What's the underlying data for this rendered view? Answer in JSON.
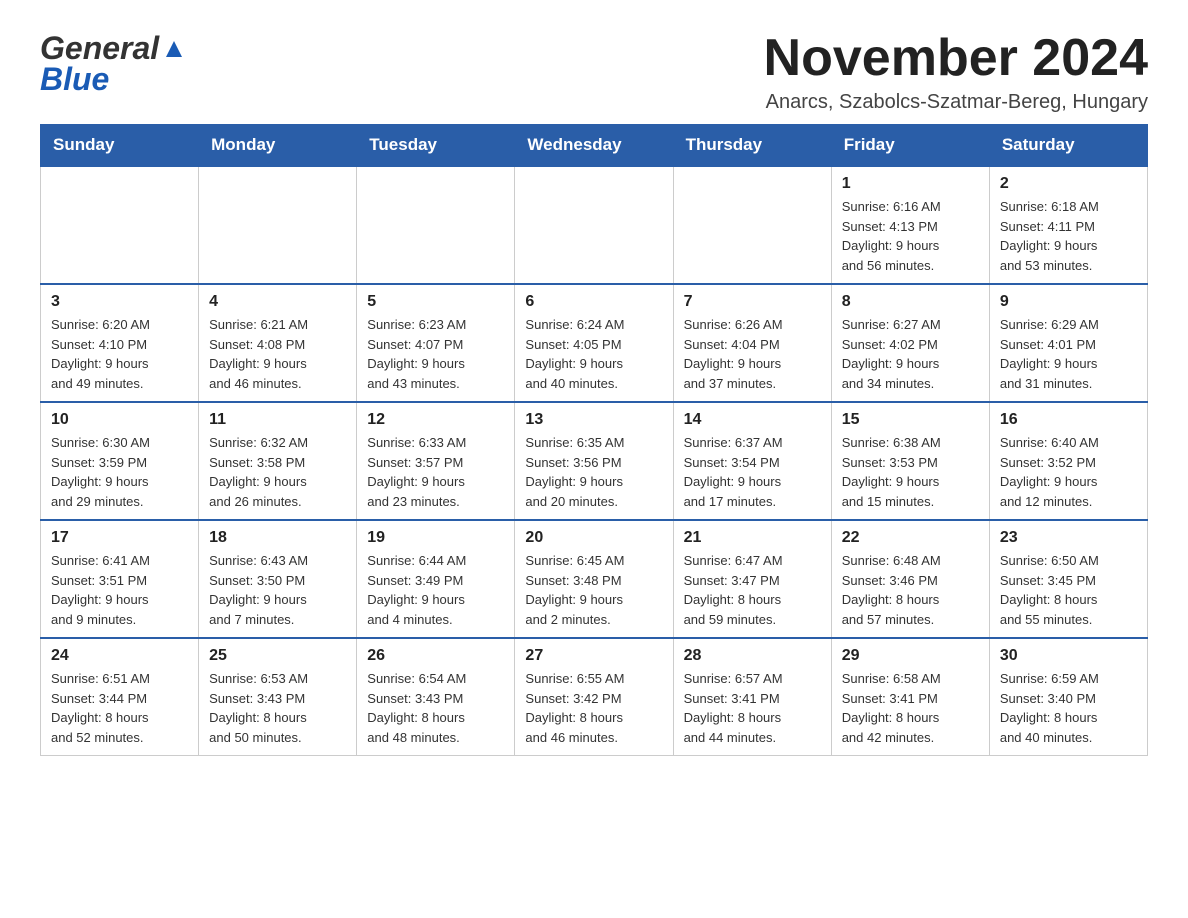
{
  "header": {
    "logo_general": "General",
    "logo_blue": "Blue",
    "month_title": "November 2024",
    "location": "Anarcs, Szabolcs-Szatmar-Bereg, Hungary"
  },
  "days_of_week": [
    "Sunday",
    "Monday",
    "Tuesday",
    "Wednesday",
    "Thursday",
    "Friday",
    "Saturday"
  ],
  "weeks": [
    {
      "days": [
        {
          "number": "",
          "info": ""
        },
        {
          "number": "",
          "info": ""
        },
        {
          "number": "",
          "info": ""
        },
        {
          "number": "",
          "info": ""
        },
        {
          "number": "",
          "info": ""
        },
        {
          "number": "1",
          "info": "Sunrise: 6:16 AM\nSunset: 4:13 PM\nDaylight: 9 hours\nand 56 minutes."
        },
        {
          "number": "2",
          "info": "Sunrise: 6:18 AM\nSunset: 4:11 PM\nDaylight: 9 hours\nand 53 minutes."
        }
      ]
    },
    {
      "days": [
        {
          "number": "3",
          "info": "Sunrise: 6:20 AM\nSunset: 4:10 PM\nDaylight: 9 hours\nand 49 minutes."
        },
        {
          "number": "4",
          "info": "Sunrise: 6:21 AM\nSunset: 4:08 PM\nDaylight: 9 hours\nand 46 minutes."
        },
        {
          "number": "5",
          "info": "Sunrise: 6:23 AM\nSunset: 4:07 PM\nDaylight: 9 hours\nand 43 minutes."
        },
        {
          "number": "6",
          "info": "Sunrise: 6:24 AM\nSunset: 4:05 PM\nDaylight: 9 hours\nand 40 minutes."
        },
        {
          "number": "7",
          "info": "Sunrise: 6:26 AM\nSunset: 4:04 PM\nDaylight: 9 hours\nand 37 minutes."
        },
        {
          "number": "8",
          "info": "Sunrise: 6:27 AM\nSunset: 4:02 PM\nDaylight: 9 hours\nand 34 minutes."
        },
        {
          "number": "9",
          "info": "Sunrise: 6:29 AM\nSunset: 4:01 PM\nDaylight: 9 hours\nand 31 minutes."
        }
      ]
    },
    {
      "days": [
        {
          "number": "10",
          "info": "Sunrise: 6:30 AM\nSunset: 3:59 PM\nDaylight: 9 hours\nand 29 minutes."
        },
        {
          "number": "11",
          "info": "Sunrise: 6:32 AM\nSunset: 3:58 PM\nDaylight: 9 hours\nand 26 minutes."
        },
        {
          "number": "12",
          "info": "Sunrise: 6:33 AM\nSunset: 3:57 PM\nDaylight: 9 hours\nand 23 minutes."
        },
        {
          "number": "13",
          "info": "Sunrise: 6:35 AM\nSunset: 3:56 PM\nDaylight: 9 hours\nand 20 minutes."
        },
        {
          "number": "14",
          "info": "Sunrise: 6:37 AM\nSunset: 3:54 PM\nDaylight: 9 hours\nand 17 minutes."
        },
        {
          "number": "15",
          "info": "Sunrise: 6:38 AM\nSunset: 3:53 PM\nDaylight: 9 hours\nand 15 minutes."
        },
        {
          "number": "16",
          "info": "Sunrise: 6:40 AM\nSunset: 3:52 PM\nDaylight: 9 hours\nand 12 minutes."
        }
      ]
    },
    {
      "days": [
        {
          "number": "17",
          "info": "Sunrise: 6:41 AM\nSunset: 3:51 PM\nDaylight: 9 hours\nand 9 minutes."
        },
        {
          "number": "18",
          "info": "Sunrise: 6:43 AM\nSunset: 3:50 PM\nDaylight: 9 hours\nand 7 minutes."
        },
        {
          "number": "19",
          "info": "Sunrise: 6:44 AM\nSunset: 3:49 PM\nDaylight: 9 hours\nand 4 minutes."
        },
        {
          "number": "20",
          "info": "Sunrise: 6:45 AM\nSunset: 3:48 PM\nDaylight: 9 hours\nand 2 minutes."
        },
        {
          "number": "21",
          "info": "Sunrise: 6:47 AM\nSunset: 3:47 PM\nDaylight: 8 hours\nand 59 minutes."
        },
        {
          "number": "22",
          "info": "Sunrise: 6:48 AM\nSunset: 3:46 PM\nDaylight: 8 hours\nand 57 minutes."
        },
        {
          "number": "23",
          "info": "Sunrise: 6:50 AM\nSunset: 3:45 PM\nDaylight: 8 hours\nand 55 minutes."
        }
      ]
    },
    {
      "days": [
        {
          "number": "24",
          "info": "Sunrise: 6:51 AM\nSunset: 3:44 PM\nDaylight: 8 hours\nand 52 minutes."
        },
        {
          "number": "25",
          "info": "Sunrise: 6:53 AM\nSunset: 3:43 PM\nDaylight: 8 hours\nand 50 minutes."
        },
        {
          "number": "26",
          "info": "Sunrise: 6:54 AM\nSunset: 3:43 PM\nDaylight: 8 hours\nand 48 minutes."
        },
        {
          "number": "27",
          "info": "Sunrise: 6:55 AM\nSunset: 3:42 PM\nDaylight: 8 hours\nand 46 minutes."
        },
        {
          "number": "28",
          "info": "Sunrise: 6:57 AM\nSunset: 3:41 PM\nDaylight: 8 hours\nand 44 minutes."
        },
        {
          "number": "29",
          "info": "Sunrise: 6:58 AM\nSunset: 3:41 PM\nDaylight: 8 hours\nand 42 minutes."
        },
        {
          "number": "30",
          "info": "Sunrise: 6:59 AM\nSunset: 3:40 PM\nDaylight: 8 hours\nand 40 minutes."
        }
      ]
    }
  ]
}
